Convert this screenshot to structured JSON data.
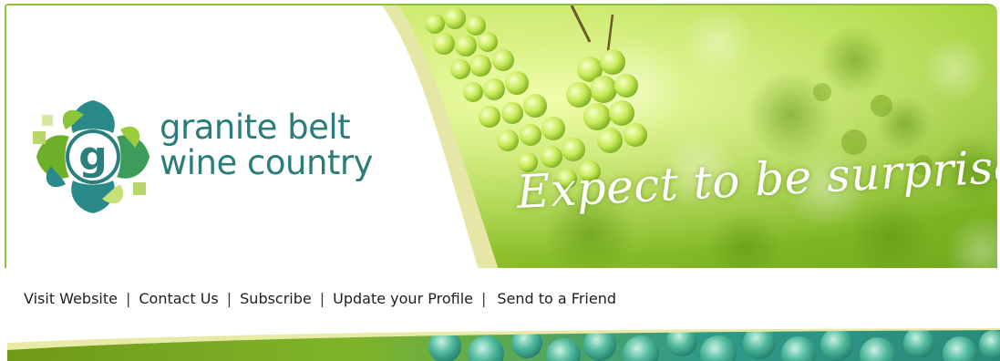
{
  "banner": {
    "brand_line1": "granite belt",
    "brand_line2": "wine country",
    "tagline": "Expect to be surprised",
    "logo_icon": "grape-leaf-g-logo-icon",
    "colors": {
      "border": "#8fbf3a",
      "brand_teal": "#2a7d7a",
      "grape_light": "#d9f26a",
      "grape_dark": "#7fb21c"
    }
  },
  "nav": {
    "items": [
      {
        "label": "Visit Website"
      },
      {
        "label": "Contact Us"
      },
      {
        "label": "Subscribe"
      },
      {
        "label": "Update your Profile"
      },
      {
        "label": "Send to a Friend"
      }
    ],
    "separator": "|"
  }
}
